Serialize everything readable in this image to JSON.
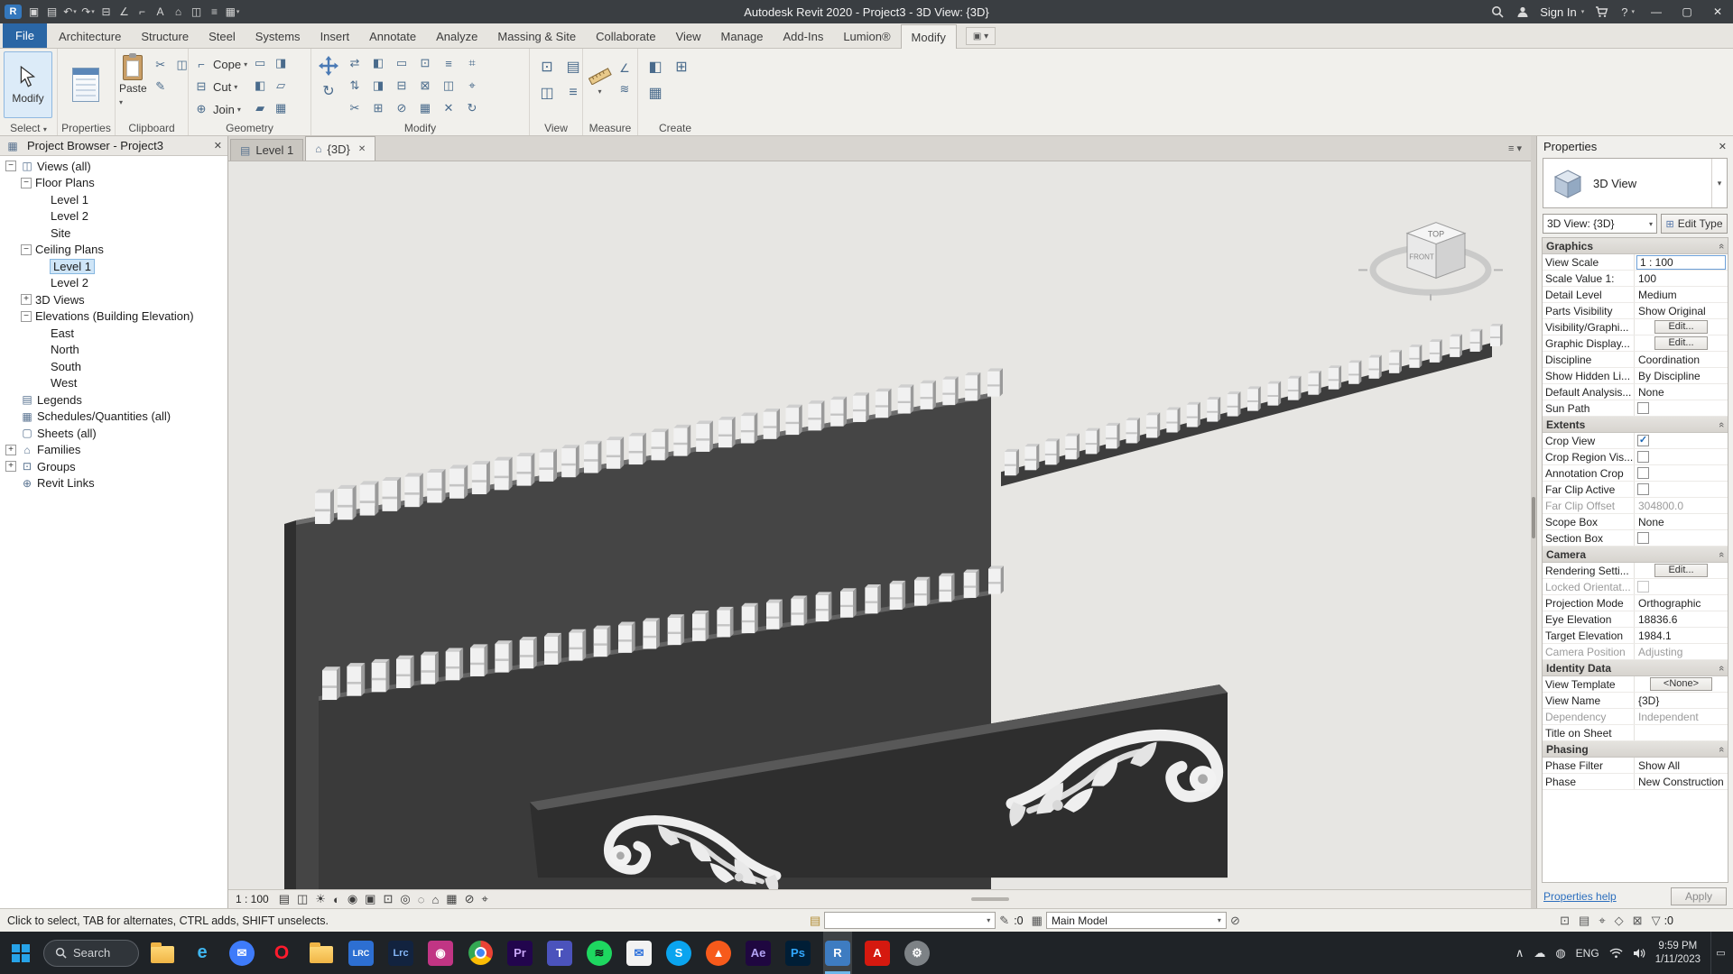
{
  "glyphs": {
    "close": "✕",
    "caret_down": "▾",
    "collapse": "«",
    "expander_open": "−",
    "expander_closed": "+",
    "list": "≡ ▾"
  },
  "titlebar": {
    "title": "Autodesk Revit 2020 - Project3 - 3D View: {3D}",
    "sign_in_label": "Sign In",
    "help_label": "?",
    "window": {
      "minimize": "—",
      "maximize": "▢",
      "close": "✕"
    },
    "qat_icons": [
      {
        "name": "revit-app-icon",
        "glyph": "R"
      },
      {
        "name": "save-icon",
        "glyph": "▣"
      },
      {
        "name": "open-icon",
        "glyph": "▤"
      },
      {
        "name": "undo-icon",
        "glyph": "↶",
        "caret": true
      },
      {
        "name": "redo-icon",
        "glyph": "↷",
        "caret": true
      },
      {
        "name": "print-icon",
        "glyph": "⊟"
      },
      {
        "name": "measure-icon",
        "glyph": "∠"
      },
      {
        "name": "aligned-dimension-icon",
        "glyph": "⌐"
      },
      {
        "name": "text-icon",
        "glyph": "A"
      },
      {
        "name": "default-3d-view-icon",
        "glyph": "⌂"
      },
      {
        "name": "section-icon",
        "glyph": "◫"
      },
      {
        "name": "thin-lines-icon",
        "glyph": "≡"
      },
      {
        "name": "switch-windows-icon",
        "glyph": "▦",
        "caret": true
      }
    ]
  },
  "ribbon": {
    "tabs": [
      "File",
      "Architecture",
      "Structure",
      "Steel",
      "Systems",
      "Insert",
      "Annotate",
      "Analyze",
      "Massing & Site",
      "Collaborate",
      "View",
      "Manage",
      "Add-Ins",
      "Lumion®",
      "Modify"
    ],
    "active_tab": "Modify",
    "select_panel": {
      "label": "Select",
      "big_button_label": "Modify"
    },
    "properties_panel": {
      "label": "Properties"
    },
    "clipboard_panel": {
      "label": "Clipboard",
      "paste_label": "Paste",
      "small_icons": [
        {
          "name": "cut-to-clipboard-icon",
          "glyph": "✂"
        },
        {
          "name": "copy-to-clipboard-icon",
          "glyph": "◫"
        },
        {
          "name": "match-type-properties-icon",
          "glyph": "✎"
        }
      ]
    },
    "geometry_panel": {
      "label": "Geometry",
      "buttons": [
        "Cope",
        "Cut",
        "Join"
      ],
      "button_icons": [
        {
          "name": "cope-icon",
          "glyph": "⌐"
        },
        {
          "name": "cut-geometry-icon",
          "glyph": "⊟"
        },
        {
          "name": "join-geometry-icon",
          "glyph": "⊕"
        }
      ],
      "cluster_icons": [
        {
          "name": "apply-coping-icon",
          "glyph": "▭"
        },
        {
          "name": "remove-coping-icon",
          "glyph": "◨"
        },
        {
          "name": "cut-out-icon",
          "glyph": "◧"
        },
        {
          "name": "uncut-icon",
          "glyph": "▱"
        },
        {
          "name": "join-options-icon",
          "glyph": "▰"
        },
        {
          "name": "unjoin-icon",
          "glyph": "▦"
        }
      ]
    },
    "modify_panel": {
      "label": "Modify",
      "grid_icons": [
        {
          "name": "align-icon",
          "glyph": "⇄"
        },
        {
          "name": "offset-icon",
          "glyph": "◧"
        },
        {
          "name": "mirror-icon",
          "glyph": "▭"
        },
        {
          "name": "extend-icon",
          "glyph": "⊡"
        },
        {
          "name": "split-icon",
          "glyph": "≡"
        },
        {
          "name": "array-icon",
          "glyph": "⌗"
        },
        {
          "name": "align-vertical-icon",
          "glyph": "⇅"
        },
        {
          "name": "mirror-axis-icon",
          "glyph": "◨"
        },
        {
          "name": "trim-icon",
          "glyph": "⊟"
        },
        {
          "name": "delete-icon",
          "glyph": "⊠"
        },
        {
          "name": "copy-icon",
          "glyph": "◫"
        },
        {
          "name": "pin-icon",
          "glyph": "⌖"
        },
        {
          "name": "scale-icon",
          "glyph": "✂"
        },
        {
          "name": "unpin-icon",
          "glyph": "⊞"
        },
        {
          "name": "demolish-icon",
          "glyph": "⊘"
        },
        {
          "name": "wall-joins-icon",
          "glyph": "▦"
        },
        {
          "name": "cut-profile-icon",
          "glyph": "✕"
        },
        {
          "name": "rotate-small-icon",
          "glyph": "↻"
        }
      ]
    },
    "view_panel": {
      "label": "View",
      "icons": [
        {
          "name": "visibility-graphics-icon",
          "glyph": "⊡"
        },
        {
          "name": "thin-lines-view-icon",
          "glyph": "▤"
        },
        {
          "name": "show-hidden-lines-icon",
          "glyph": "◫"
        },
        {
          "name": "close-inactive-icon",
          "glyph": "≡"
        }
      ]
    },
    "measure_panel": {
      "label": "Measure",
      "icons": [
        {
          "name": "measure-between-icon",
          "glyph": "∠"
        },
        {
          "name": "measure-along-icon",
          "glyph": "≋"
        }
      ]
    },
    "create_panel": {
      "label": "Create",
      "icons": [
        {
          "name": "create-group-icon",
          "glyph": "◧"
        },
        {
          "name": "create-assembly-icon",
          "glyph": "⊞"
        },
        {
          "name": "create-similar-icon",
          "glyph": "▦"
        }
      ]
    }
  },
  "project_browser": {
    "title": "Project Browser - Project3",
    "items": [
      {
        "label": "Views (all)",
        "level": 0,
        "expander": "minus",
        "icon": "views",
        "glyph": "◫"
      },
      {
        "label": "Floor Plans",
        "level": 1,
        "expander": "minus"
      },
      {
        "label": "Level 1",
        "level": 2
      },
      {
        "label": "Level 2",
        "level": 2
      },
      {
        "label": "Site",
        "level": 2
      },
      {
        "label": "Ceiling Plans",
        "level": 1,
        "expander": "minus"
      },
      {
        "label": "Level 1",
        "level": 2,
        "selected": true
      },
      {
        "label": "Level 2",
        "level": 2
      },
      {
        "label": "3D Views",
        "level": 1,
        "expander": "plus"
      },
      {
        "label": "Elevations (Building Elevation)",
        "level": 1,
        "expander": "minus"
      },
      {
        "label": "East",
        "level": 2
      },
      {
        "label": "North",
        "level": 2
      },
      {
        "label": "South",
        "level": 2
      },
      {
        "label": "West",
        "level": 2
      },
      {
        "label": "Legends",
        "level": 0,
        "icon": "legends",
        "glyph": "▤"
      },
      {
        "label": "Schedules/Quantities (all)",
        "level": 0,
        "icon": "schedules",
        "glyph": "▦"
      },
      {
        "label": "Sheets (all)",
        "level": 0,
        "icon": "sheets",
        "glyph": "▢"
      },
      {
        "label": "Families",
        "level": 0,
        "expander": "plus",
        "icon": "families",
        "glyph": "⌂"
      },
      {
        "label": "Groups",
        "level": 0,
        "expander": "plus",
        "icon": "groups",
        "glyph": "⊡"
      },
      {
        "label": "Revit Links",
        "level": 0,
        "icon": "revit-links",
        "glyph": "⊕"
      }
    ]
  },
  "viewport": {
    "tabs": [
      {
        "label": "Level 1",
        "icon": "floor-plan-icon",
        "glyph": "▤",
        "active": false
      },
      {
        "label": "{3D}",
        "icon": "three-d-view-icon",
        "glyph": "⌂",
        "active": true
      }
    ]
  },
  "view_cube": {
    "top_label": "TOP",
    "front_label": "FRONT"
  },
  "view_control_bar": {
    "scale_label": "1 : 100",
    "icons": [
      {
        "name": "detail-level-icon",
        "glyph": "▤"
      },
      {
        "name": "visual-style-icon",
        "glyph": "◫"
      },
      {
        "name": "sun-path-icon",
        "glyph": "☀"
      },
      {
        "name": "shadows-icon",
        "glyph": "◐"
      },
      {
        "name": "rendering-dialog-icon",
        "glyph": "◉"
      },
      {
        "name": "crop-view-icon",
        "glyph": "▣"
      },
      {
        "name": "show-crop-icon",
        "glyph": "⊡"
      },
      {
        "name": "temporary-hide-isolate-icon",
        "glyph": "◎"
      },
      {
        "name": "reveal-hidden-icon",
        "glyph": "◌"
      },
      {
        "name": "worksharing-display-icon",
        "glyph": "⌂"
      },
      {
        "name": "temporary-view-properties-icon",
        "glyph": "▦"
      },
      {
        "name": "show-analytical-icon",
        "glyph": "⊘"
      },
      {
        "name": "show-constraints-icon",
        "glyph": "⌖"
      }
    ]
  },
  "properties": {
    "title": "Properties",
    "type_name": "3D View",
    "instance_selector": "3D View: {3D}",
    "edit_type_label": "Edit Type",
    "help_link": "Properties help",
    "apply_label": "Apply",
    "sections": [
      {
        "header": "Graphics",
        "rows": [
          {
            "label": "View Scale",
            "value": "1 : 100",
            "kind": "input-selected"
          },
          {
            "label": "Scale Value    1:",
            "value": "100",
            "kind": "text"
          },
          {
            "label": "Detail Level",
            "value": "Medium",
            "kind": "text"
          },
          {
            "label": "Parts Visibility",
            "value": "Show Original",
            "kind": "text"
          },
          {
            "label": "Visibility/Graphi...",
            "value": "Edit...",
            "kind": "button"
          },
          {
            "label": "Graphic Display...",
            "value": "Edit...",
            "kind": "button"
          },
          {
            "label": "Discipline",
            "value": "Coordination",
            "kind": "text"
          },
          {
            "label": "Show Hidden Li...",
            "value": "By Discipline",
            "kind": "text"
          },
          {
            "label": "Default Analysis...",
            "value": "None",
            "kind": "text"
          },
          {
            "label": "Sun Path",
            "kind": "checkbox",
            "checked": false
          }
        ]
      },
      {
        "header": "Extents",
        "rows": [
          {
            "label": "Crop View",
            "kind": "checkbox",
            "checked": true
          },
          {
            "label": "Crop Region Vis...",
            "kind": "checkbox",
            "checked": false
          },
          {
            "label": "Annotation Crop",
            "kind": "checkbox",
            "checked": false
          },
          {
            "label": "Far Clip Active",
            "kind": "checkbox",
            "checked": false
          },
          {
            "label": "Far Clip Offset",
            "value": "304800.0",
            "kind": "text",
            "disabled": true
          },
          {
            "label": "Scope Box",
            "value": "None",
            "kind": "text"
          },
          {
            "label": "Section Box",
            "kind": "checkbox",
            "checked": false
          }
        ]
      },
      {
        "header": "Camera",
        "rows": [
          {
            "label": "Rendering Setti...",
            "value": "Edit...",
            "kind": "button"
          },
          {
            "label": "Locked Orientat...",
            "kind": "checkbox",
            "checked": false,
            "disabled": true
          },
          {
            "label": "Projection Mode",
            "value": "Orthographic",
            "kind": "text"
          },
          {
            "label": "Eye Elevation",
            "value": "18836.6",
            "kind": "text"
          },
          {
            "label": "Target Elevation",
            "value": "1984.1",
            "kind": "text"
          },
          {
            "label": "Camera Position",
            "value": "Adjusting",
            "kind": "text",
            "disabled": true
          }
        ]
      },
      {
        "header": "Identity Data",
        "rows": [
          {
            "label": "View Template",
            "value": "<None>",
            "kind": "button"
          },
          {
            "label": "View Name",
            "value": "{3D}",
            "kind": "text"
          },
          {
            "label": "Dependency",
            "value": "Independent",
            "kind": "text",
            "disabled": true
          },
          {
            "label": "Title on Sheet",
            "value": "",
            "kind": "text"
          }
        ]
      },
      {
        "header": "Phasing",
        "rows": [
          {
            "label": "Phase Filter",
            "value": "Show All",
            "kind": "text"
          },
          {
            "label": "Phase",
            "value": "New Construction",
            "kind": "text"
          }
        ]
      }
    ]
  },
  "status_bar": {
    "hint": "Click to select, TAB for alternates, CTRL adds, SHIFT unselects.",
    "workset_value": "",
    "editable_count": ":0",
    "design_option_value": "Main Model",
    "filter_count": ":0",
    "icons": {
      "worksets": "▤",
      "editable": "✎",
      "design_options": "▦",
      "exclude_options": "⊘"
    },
    "right_icons": [
      {
        "name": "select-link-icon",
        "glyph": "⊡"
      },
      {
        "name": "select-underlay-icon",
        "glyph": "▤"
      },
      {
        "name": "select-pinned-icon",
        "glyph": "⌖"
      },
      {
        "name": "select-by-face-icon",
        "glyph": "◇"
      },
      {
        "name": "drag-on-selection-icon",
        "glyph": "⊠"
      },
      {
        "name": "filter-icon",
        "glyph": "▽"
      }
    ]
  },
  "taskbar": {
    "search_placeholder": "Search",
    "apps": [
      {
        "name": "file-explorer",
        "shape": "folder"
      },
      {
        "name": "internet-explorer",
        "shape": "circle",
        "bg": "transparent",
        "color": "#3fb6f0",
        "text": "e",
        "fs": 20
      },
      {
        "name": "chat-app",
        "shape": "circle",
        "bg": "#3e7bfa",
        "color": "#ffffff",
        "text": "✉"
      },
      {
        "name": "opera",
        "shape": "circle",
        "bg": "transparent",
        "color": "#ff1b2d",
        "text": "O",
        "fs": 21
      },
      {
        "name": "folder-2",
        "shape": "folder"
      },
      {
        "name": "media-app",
        "shape": "square",
        "bg": "#2d6fd2",
        "color": "#ffffff",
        "text": "LRC",
        "fs": 9
      },
      {
        "name": "lightroom-classic",
        "shape": "square",
        "bg": "#12233f",
        "color": "#86b7f7",
        "text": "Lrc",
        "fs": 11
      },
      {
        "name": "instagram",
        "shape": "square",
        "bg": "#c13584",
        "color": "#ffffff",
        "text": "◉"
      },
      {
        "name": "chrome",
        "shape": "chrome"
      },
      {
        "name": "premiere-pro",
        "shape": "square",
        "bg": "#22054d",
        "color": "#c7a6f7",
        "text": "Pr"
      },
      {
        "name": "teams",
        "shape": "square",
        "bg": "#4b53bc",
        "color": "#ffffff",
        "text": "T"
      },
      {
        "name": "spotify",
        "shape": "circle",
        "bg": "#1ed760",
        "color": "#111111",
        "text": "≋"
      },
      {
        "name": "mail-app",
        "shape": "square",
        "bg": "#f2f2f2",
        "color": "#2a6fdb",
        "text": "✉"
      },
      {
        "name": "skype",
        "shape": "circle",
        "bg": "#0aa4ef",
        "color": "#ffffff",
        "text": "S"
      },
      {
        "name": "brave",
        "shape": "circle",
        "bg": "#f75a1b",
        "color": "#ffffff",
        "text": "▲"
      },
      {
        "name": "after-effects",
        "shape": "square",
        "bg": "#1f0740",
        "color": "#b4a4f5",
        "text": "Ae"
      },
      {
        "name": "photoshop",
        "shape": "square",
        "bg": "#001e36",
        "color": "#31a8ff",
        "text": "Ps"
      },
      {
        "name": "revit",
        "shape": "square",
        "bg": "#3e7cc1",
        "color": "#ffffff",
        "text": "R",
        "active": true
      },
      {
        "name": "acrobat",
        "shape": "square",
        "bg": "#d5190f",
        "color": "#ffffff",
        "text": "A"
      },
      {
        "name": "settings",
        "shape": "circle",
        "bg": "#7d8286",
        "color": "#ffffff",
        "text": "⚙"
      }
    ],
    "tray": {
      "lang": "ENG",
      "time": "9:59 PM",
      "date": "1/11/2023"
    }
  }
}
